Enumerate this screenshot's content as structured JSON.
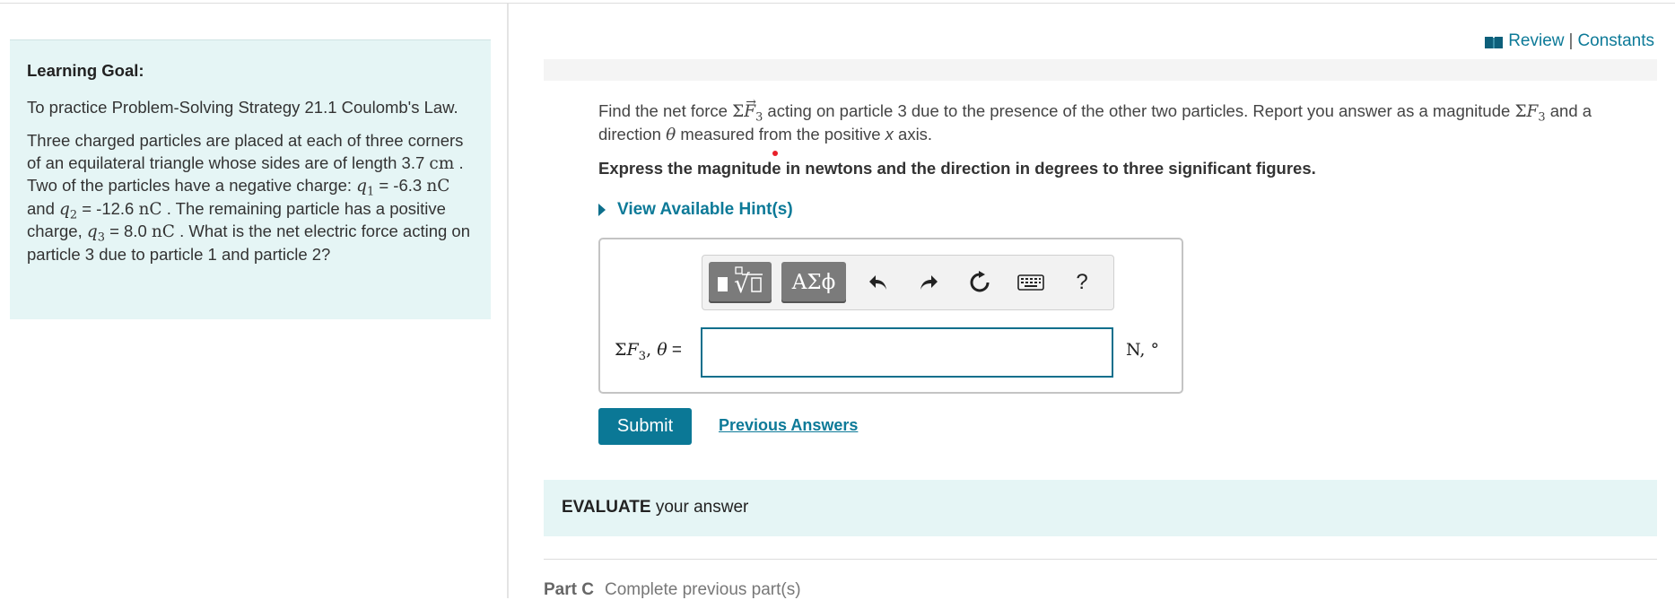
{
  "goal": {
    "title": "Learning Goal:",
    "intro": "To practice Problem-Solving Strategy 21.1 Coulomb's Law.",
    "p_a": "Three charged particles are placed at each of three corners of an equilateral triangle whose sides are of length 3.7 ",
    "unit_cm": "cm",
    "p_b": " . Two of the particles have a negative charge: ",
    "q1_sym": "q",
    "q1_sub": "1",
    "q1_val": " = -6.3 ",
    "unit_nc": "nC",
    "p_c": " and ",
    "q2_sym": "q",
    "q2_sub": "2",
    "q2_val": " = -12.6 ",
    "p_d": " . The remaining particle has a positive charge, ",
    "q3_sym": "q",
    "q3_sub": "3",
    "q3_val": " = 8.0 ",
    "p_e": " . What is the net electric force acting on particle 3 due to particle 1 and particle 2?"
  },
  "toplinks": {
    "review": "Review",
    "separator": "|",
    "constants": "Constants"
  },
  "question": {
    "t1": "Find the net force ",
    "sigma": "Σ",
    "F": "F",
    "sub3": "3",
    "t2": " acting on particle 3 due to the presence of the other two particles. Report you answer as a magnitude ",
    "t3": " and a direction ",
    "theta": "θ",
    "t4": " measured from the positive ",
    "x": "x",
    "t5": " axis."
  },
  "express": "Express the magnitude in newtons and the direction in degrees to three significant figures.",
  "hint": "View Available Hint(s)",
  "toolbar": {
    "templates_icon": "templates-icon",
    "greek_label": "ΑΣϕ",
    "undo_icon": "undo-icon",
    "redo_icon": "redo-icon",
    "reset_icon": "reset-icon",
    "keyboard_icon": "keyboard-icon",
    "help_label": "?"
  },
  "answer": {
    "label_sigma": "Σ",
    "label_F": "F",
    "label_sub": "3",
    "label_comma": ", ",
    "label_theta": "θ",
    "label_eq": " =",
    "value": "",
    "units": "N, °"
  },
  "submit": "Submit",
  "previous_answers": "Previous Answers",
  "evaluate": {
    "strong": "EVALUATE",
    "rest": " your answer"
  },
  "partc": {
    "label": "Part C",
    "status": "Complete previous part(s)"
  },
  "colors": {
    "accent": "#0b7896",
    "panel_bg": "#e5f5f5"
  }
}
